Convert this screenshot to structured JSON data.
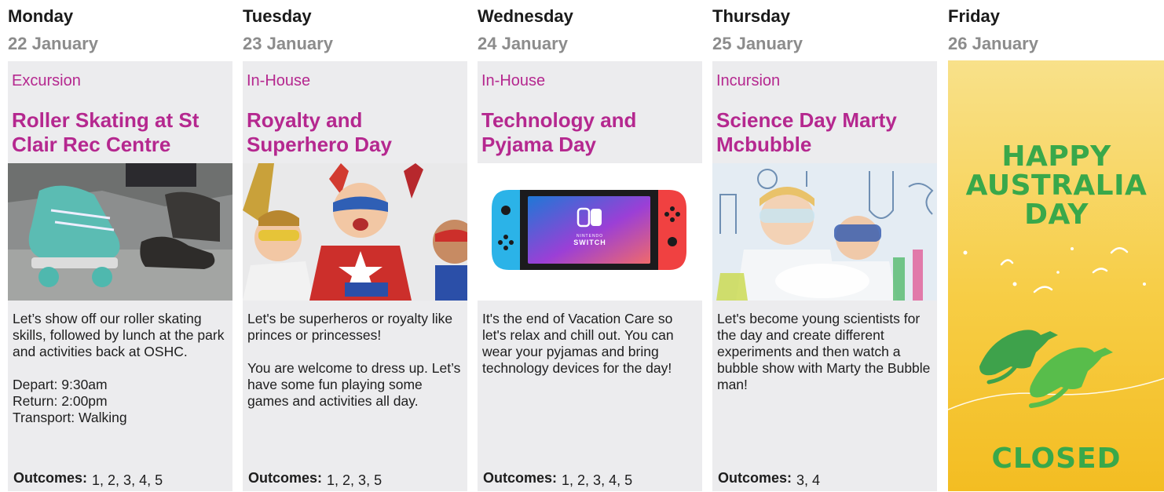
{
  "days": [
    {
      "day": "Monday",
      "date": "22 January",
      "type": "Excursion",
      "title": "Roller Skating at St Clair Rec Centre",
      "image": "roller-skates-photo",
      "description": "Let’s show off our roller skating skills, followed by lunch at the park and activities back at OSHC.\n\nDepart: 9:30am\nReturn: 2:00pm\nTransport: Walking",
      "outcomes_label": "Outcomes:",
      "outcomes": "1, 2, 3, 4, 5"
    },
    {
      "day": "Tuesday",
      "date": "23 January",
      "type": "In-House",
      "title": "Royalty and Superhero Day",
      "image": "kids-superhero-costumes-photo",
      "description": "Let's be superheros or royalty like princes or princesses!\n\nYou are welcome to dress up. Let’s have some fun playing some games and activities all day.",
      "outcomes_label": "Outcomes:",
      "outcomes": "1, 2, 3, 5"
    },
    {
      "day": "Wednesday",
      "date": "24 January",
      "type": "In-House",
      "title": "Technology and Pyjama Day",
      "image": "game-console-photo",
      "console_text_1": "NINTENDO",
      "console_text_2": "SWITCH",
      "description": "It's the end of Vacation Care so let's relax and chill out. You can wear your pyjamas and bring technology devices for the day!",
      "outcomes_label": "Outcomes:",
      "outcomes": "1, 2, 3, 4, 5"
    },
    {
      "day": "Thursday",
      "date": "25 January",
      "type": "Incursion",
      "title": "Science Day Marty Mcbubble",
      "image": "kids-science-experiment-photo",
      "description": "Let's become young scientists for the day and create different experiments and then watch a bubble show with Marty the Bubble man!",
      "outcomes_label": "Outcomes:",
      "outcomes": "3, 4"
    }
  ],
  "friday": {
    "day": "Friday",
    "date": "26 January",
    "line1": "HAPPY",
    "line2": "AUSTRALIA",
    "line3": "DAY",
    "closed": "CLOSED",
    "illustration": "kangaroo-icon",
    "colors": {
      "green": "#39a84a",
      "yellow": "#f7cd45"
    }
  },
  "colors": {
    "accent": "#b5288f",
    "card_bg": "#ececee"
  }
}
